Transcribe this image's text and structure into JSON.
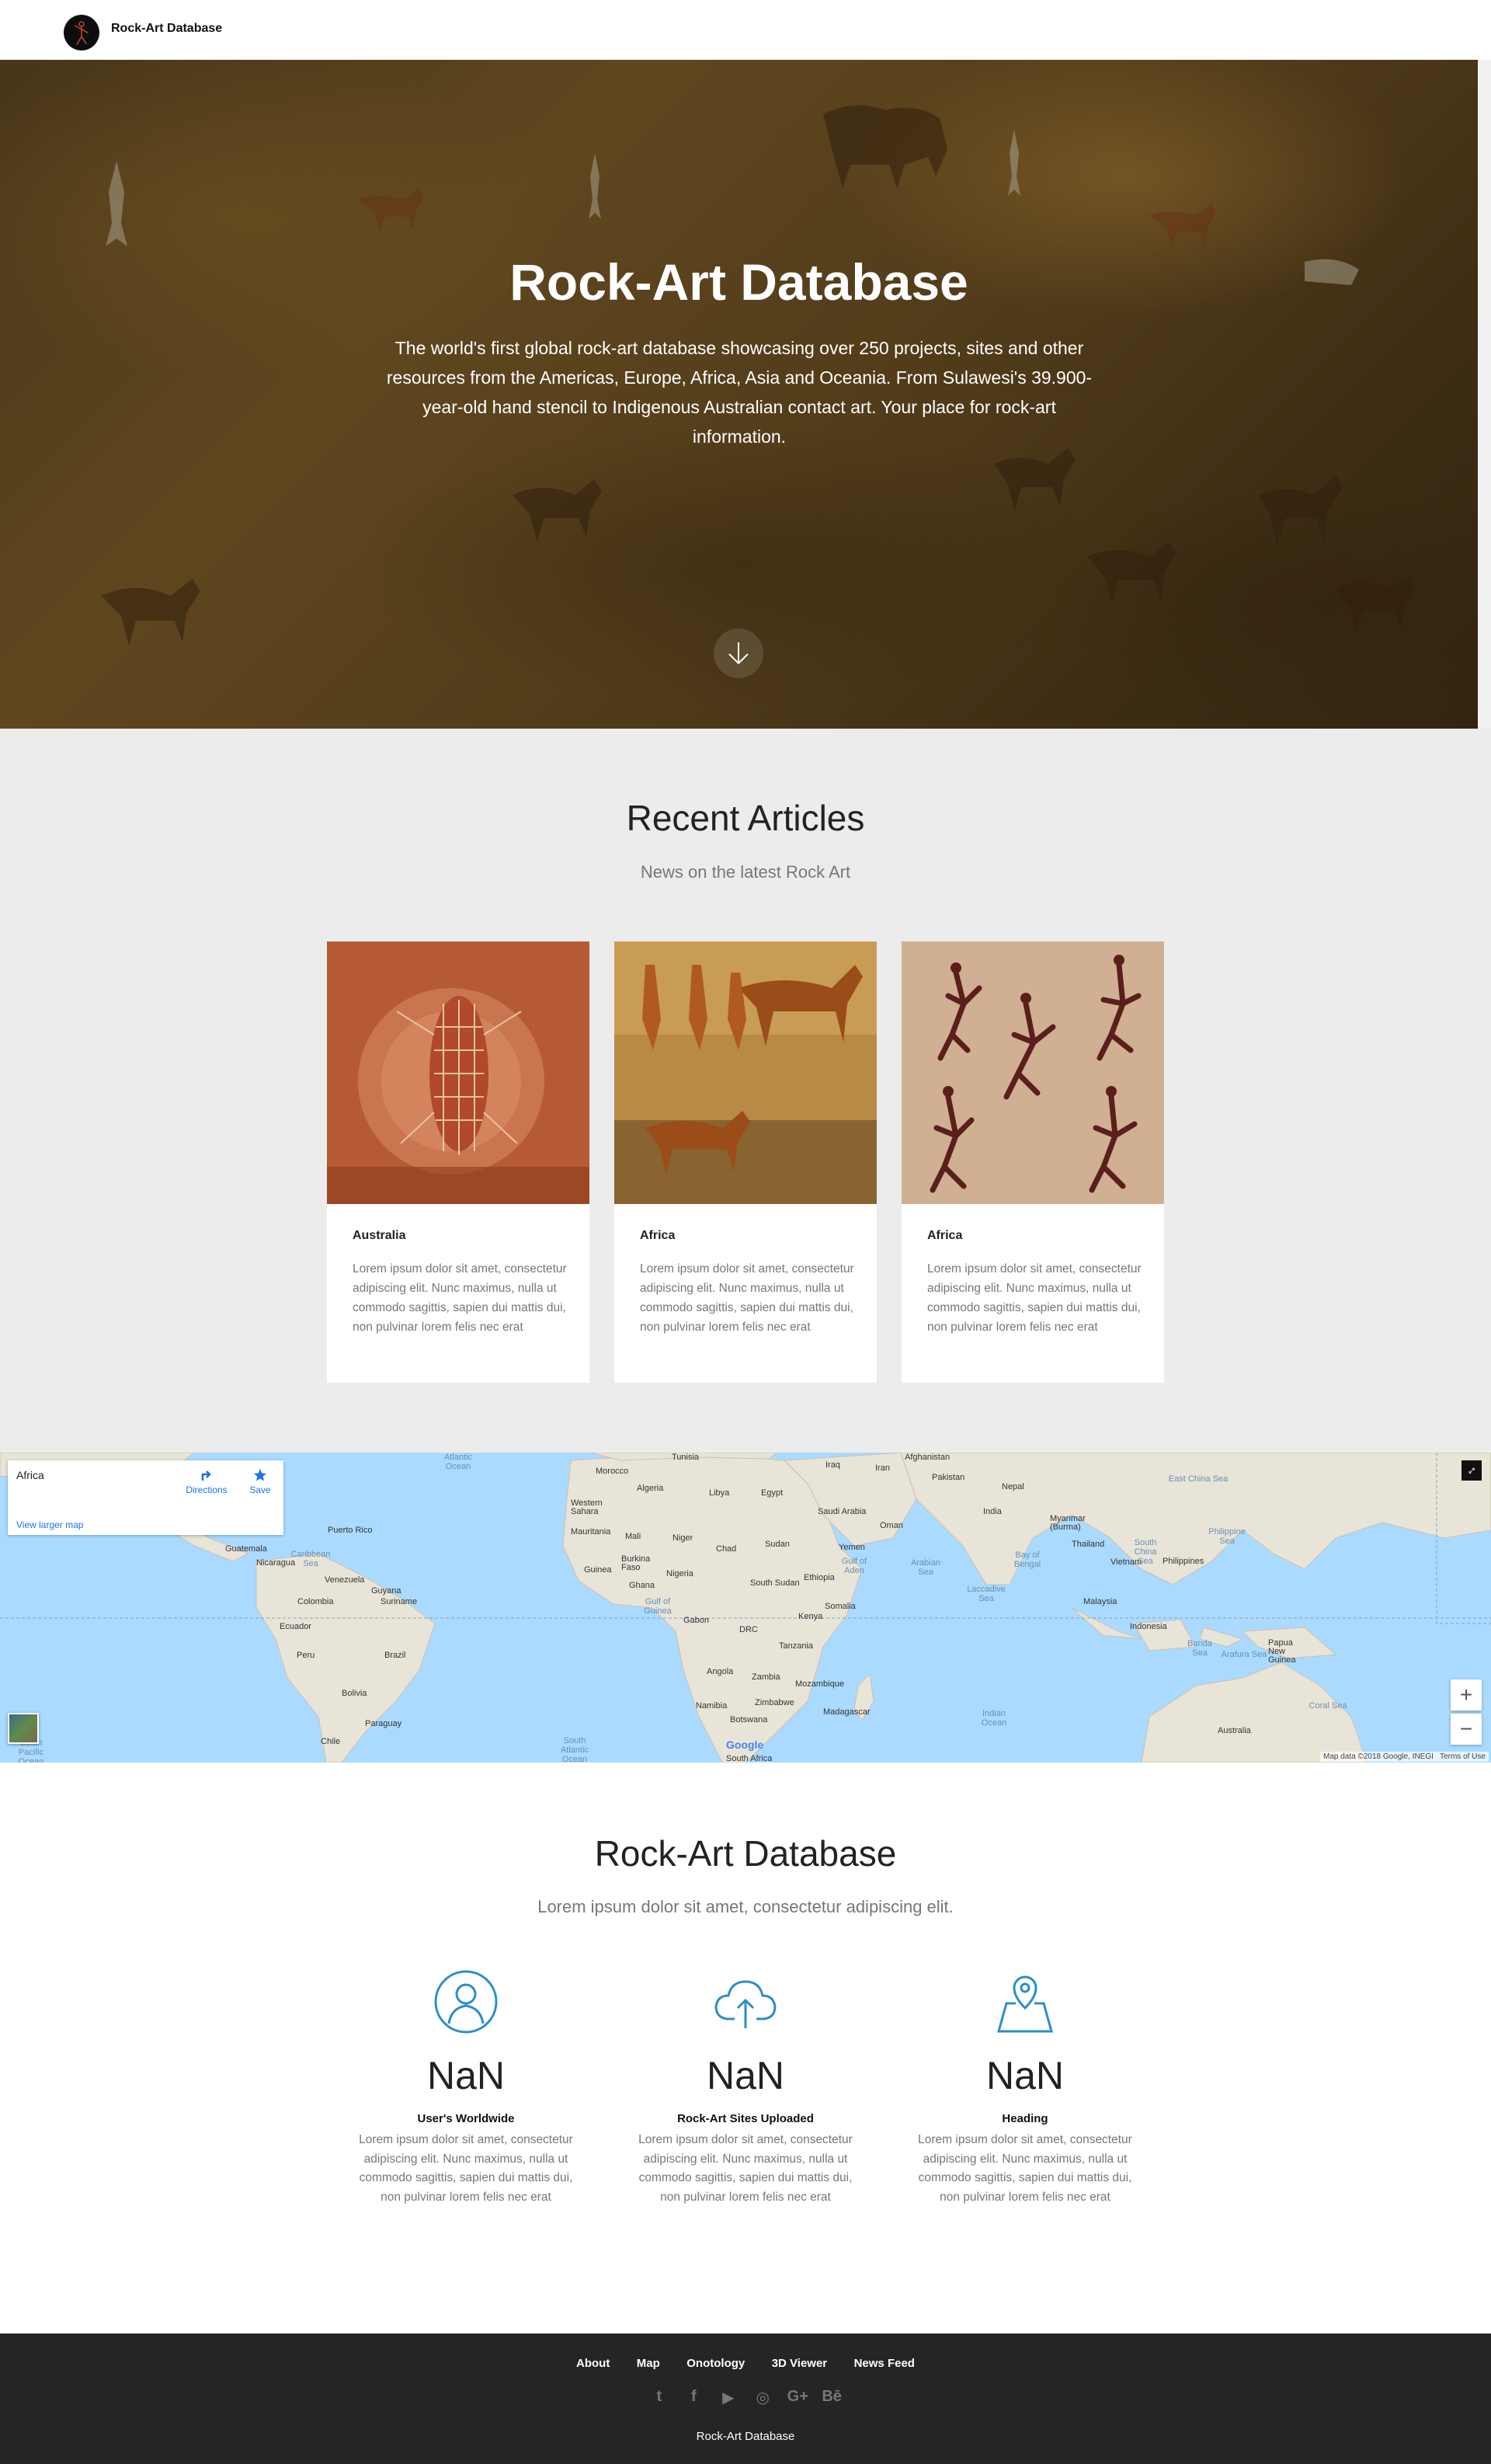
{
  "nav": {
    "brand": "Rock-Art Database",
    "logo_icon": "rock-art-figure-icon"
  },
  "hero": {
    "title": "Rock-Art Database",
    "subtitle": "The world's first global rock-art database showcasing over 250 projects, sites and other resources from the Americas, Europe, Africa, Asia and Oceania. From Sulawesi's 39.900-year-old hand stencil to Indigenous Australian contact art. Your place for rock-art information.",
    "scroll_icon": "arrow-down-icon"
  },
  "articles": {
    "title": "Recent Articles",
    "subtitle": "News on the latest Rock Art",
    "cards": [
      {
        "title": "Australia",
        "text": "Lorem ipsum dolor sit amet, consectetur adipiscing elit. Nunc maximus, nulla ut commodo sagittis, sapien dui mattis dui, non pulvinar lorem felis nec erat"
      },
      {
        "title": "Africa",
        "text": "Lorem ipsum dolor sit amet, consectetur adipiscing elit. Nunc maximus, nulla ut commodo sagittis, sapien dui mattis dui, non pulvinar lorem felis nec erat"
      },
      {
        "title": "Africa",
        "text": "Lorem ipsum dolor sit amet, consectetur adipiscing elit. Nunc maximus, nulla ut commodo sagittis, sapien dui mattis dui, non pulvinar lorem felis nec erat"
      }
    ]
  },
  "map": {
    "place": "Africa",
    "view_larger": "View larger map",
    "directions": "Directions",
    "save": "Save",
    "attribution": "Map data ©2018 Google, INEGI",
    "terms": "Terms of Use",
    "google": "Google",
    "zoom_in": "+",
    "zoom_out": "−",
    "labels": {
      "atlantic": "Atlantic Ocean",
      "indian": "Indian Ocean",
      "south_atlantic": "South Atlantic Ocean",
      "south_pacific": "South Pacific Ocean",
      "morocco": "Morocco",
      "tunisia": "Tunisia",
      "algeria": "Algeria",
      "libya": "Libya",
      "egypt": "Egypt",
      "western_sahara": "Western Sahara",
      "mauritania": "Mauritania",
      "mali": "Mali",
      "niger": "Niger",
      "chad": "Chad",
      "sudan": "Sudan",
      "nigeria": "Nigeria",
      "burkina": "Burkina Faso",
      "ghana": "Ghana",
      "guinea": "Guinea",
      "ethiopia": "Ethiopia",
      "south_sudan": "South Sudan",
      "somalia": "Somalia",
      "kenya": "Kenya",
      "drc": "DRC",
      "tanzania": "Tanzania",
      "angola": "Angola",
      "zambia": "Zambia",
      "mozambique": "Mozambique",
      "zimbabwe": "Zimbabwe",
      "namibia": "Namibia",
      "botswana": "Botswana",
      "madagascar": "Madagascar",
      "south_africa": "South Africa",
      "gabon": "Gabon",
      "saudi": "Saudi Arabia",
      "yemen": "Yemen",
      "oman": "Oman",
      "iraq": "Iraq",
      "iran": "Iran",
      "afghanistan": "Afghanistan",
      "pakistan": "Pakistan",
      "india": "India",
      "nepal": "Nepal",
      "myanmar": "Myanmar (Burma)",
      "thailand": "Thailand",
      "vietnam": "Vietnam",
      "philippines": "Philippines",
      "malaysia": "Malaysia",
      "indonesia": "Indonesia",
      "png": "Papua New Guinea",
      "australia": "Australia",
      "venezuela": "Venezuela",
      "colombia": "Colombia",
      "guyana": "Guyana",
      "suriname": "Suriname",
      "ecuador": "Ecuador",
      "peru": "Peru",
      "brazil": "Brazil",
      "bolivia": "Bolivia",
      "paraguay": "Paraguay",
      "chile": "Chile",
      "guatemala": "Guatemala",
      "nicaragua": "Nicaragua",
      "puerto_rico": "Puerto Rico",
      "caribbean": "Caribbean Sea",
      "arabian_sea": "Arabian Sea",
      "bay_bengal": "Bay of Bengal",
      "laccadive": "Laccadive Sea",
      "gulf_aden": "Gulf of Aden",
      "gulf_guinea": "Gulf of Guinea",
      "south_china": "South China Sea",
      "philippine_sea": "Philippine Sea",
      "east_china": "East China Sea",
      "banda": "Banda Sea",
      "arafura": "Arafura Sea",
      "coral": "Coral Sea"
    }
  },
  "stats": {
    "title": "Rock-Art Database",
    "subtitle": "Lorem ipsum dolor sit amet, consectetur adipiscing elit.",
    "items": [
      {
        "icon": "user-icon",
        "value": "NaN",
        "heading": "User's Worldwide",
        "text": "Lorem ipsum dolor sit amet, consectetur adipiscing elit. Nunc maximus, nulla ut commodo sagittis, sapien dui mattis dui, non pulvinar lorem felis nec erat"
      },
      {
        "icon": "cloud-upload-icon",
        "value": "NaN",
        "heading": "Rock-Art Sites Uploaded",
        "text": "Lorem ipsum dolor sit amet, consectetur adipiscing elit. Nunc maximus, nulla ut commodo sagittis, sapien dui mattis dui, non pulvinar lorem felis nec erat"
      },
      {
        "icon": "map-pin-icon",
        "value": "NaN",
        "heading": "Heading",
        "text": "Lorem ipsum dolor sit amet, consectetur adipiscing elit. Nunc maximus, nulla ut commodo sagittis, sapien dui mattis dui, non pulvinar lorem felis nec erat"
      }
    ]
  },
  "footer": {
    "links": [
      "About",
      "Map",
      "Onotology",
      "3D Viewer",
      "News Feed"
    ],
    "social": [
      "twitter-icon",
      "facebook-icon",
      "youtube-icon",
      "instagram-icon",
      "google-plus-icon",
      "behance-icon"
    ],
    "social_glyphs": [
      "t",
      "f",
      "▶",
      "◎",
      "G+",
      "Bē"
    ],
    "copyright": "Rock-Art Database"
  },
  "colors": {
    "accent": "#2c8ec9",
    "footer_bg": "#252525",
    "articles_bg": "#ececec",
    "map_water": "#aadaff",
    "map_land": "#e8e4d8"
  }
}
